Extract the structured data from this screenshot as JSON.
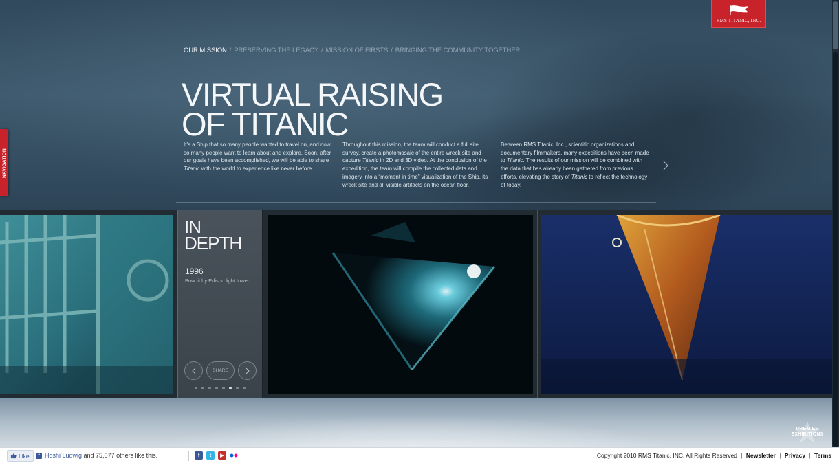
{
  "brand": {
    "logo_text": "RMS TITANIC, INC.",
    "accent_color": "#c8232a",
    "sponsor": "PREMIER EXHIBITIONS"
  },
  "navigation_tab": {
    "label": "NAVIGATION"
  },
  "breadcrumb": {
    "items": [
      {
        "label": "OUR MISSION",
        "current": true
      },
      {
        "label": "PRESERVING THE LEGACY",
        "current": false
      },
      {
        "label": "MISSION OF FIRSTS",
        "current": false
      },
      {
        "label": "BRINGING THE COMMUNITY TOGETHER",
        "current": false
      }
    ],
    "separator": "/"
  },
  "hero": {
    "title_line1": "VIRTUAL RAISING",
    "title_line2": "OF TITANIC",
    "columns": [
      {
        "parts": [
          "It's a Ship that so many people wanted to travel on, and now so many people want to learn about and explore. Soon, after our goals have been accomplished, we will be able to share ",
          "Titanic",
          " with the world to experience like never before."
        ]
      },
      {
        "parts": [
          "Throughout this mission, the team will conduct a full site survey, create a photomosaic of the entire wreck site and capture ",
          "Titanic",
          " in 2D and 3D video. At the conclusion of the expedition, the team will compile the collected data and imagery into a “moment in time” visualization of the Ship, its wreck site and all visible artifacts on the ocean floor."
        ]
      },
      {
        "parts": [
          "Between RMS Titanic, Inc., scientific organizations and documentary filmmakers, many expeditions have been made to ",
          "Titanic",
          ". The results of our mission will be combined with the data that has already been gathered from previous efforts, elevating the story of ",
          "Titanic",
          " to reflect the technology of today."
        ]
      }
    ],
    "next_icon": "chevron-right-icon"
  },
  "in_depth": {
    "title_line1": "IN",
    "title_line2": "DEPTH",
    "year": "1996",
    "caption": "Bow lit by Edison light tower",
    "share_label": "SHARE",
    "prev_icon": "chevron-left-icon",
    "next_icon": "chevron-right-icon",
    "dots_total": 8,
    "active_dot": 6
  },
  "gallery": {
    "photos": [
      {
        "name": "wreck-grating-photo"
      },
      {
        "name": "bow-lit-photo"
      },
      {
        "name": "rusted-bow-photo"
      }
    ]
  },
  "footer": {
    "like_label": "Like",
    "fb_user": "Hoshi Ludwig",
    "fb_suffix": " and 75,077 others like this.",
    "social": [
      "facebook-icon",
      "twitter-icon",
      "youtube-icon",
      "flickr-icon"
    ],
    "copyright": "Copyright 2010 RMS Titanic, INC. All Rights Reserved",
    "links": [
      "Newsletter",
      "Privacy",
      "Terms"
    ],
    "link_separator": "|"
  }
}
